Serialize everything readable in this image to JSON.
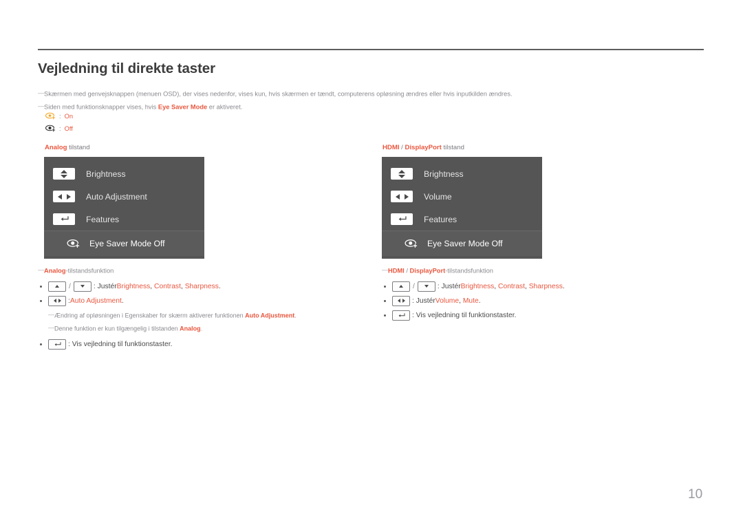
{
  "page": {
    "title": "Vejledning til direkte taster",
    "page_number": "10",
    "colors": {
      "accent": "#e8573f",
      "osd_background": "#555555",
      "osd_row_highlight": "#5b5b5b",
      "text": "#4a4a4a",
      "muted": "#8a8a90",
      "rule": "#5d5d5d",
      "page_number": "#9a9aa0"
    }
  },
  "intro": {
    "note1": "Skærmen med genvejsknappen (menuen OSD), der vises nedenfor, vises kun, hvis skærmen er tændt, computerens opløsning ændres eller hvis inputkilden ændres.",
    "note2_pre": "Siden med funktionsknapper vises, hvis ",
    "note2_hl": "Eye Saver Mode",
    "note2_post": " er aktiveret.",
    "legend": [
      {
        "icon": "eye-saver-on-icon",
        "sep": ":",
        "label": "On"
      },
      {
        "icon": "eye-saver-off-icon",
        "sep": ":",
        "label": "Off"
      }
    ]
  },
  "left_column": {
    "section_label_hl": "Analog",
    "section_label_rest": " tilstand",
    "osd": {
      "rows": [
        {
          "key": "up-down-key",
          "label": "Brightness"
        },
        {
          "key": "left-right-key",
          "label": "Auto Adjustment"
        },
        {
          "key": "enter-key",
          "label": "Features"
        }
      ],
      "eye_row": {
        "icon": "eye-saver-icon",
        "label": "Eye Saver Mode Off"
      }
    },
    "subtitle_hl": "Analog",
    "subtitle_rest": "-tilstandsfunktion",
    "bullets": [
      {
        "keys": [
          "up-key",
          "down-key"
        ],
        "prefix": ": Justér ",
        "terms": [
          "Brightness",
          "Contrast",
          "Sharpness"
        ],
        "suffix": "."
      },
      {
        "keys": [
          "left-right-key"
        ],
        "prefix": ": ",
        "terms": [
          "Auto Adjustment"
        ],
        "suffix": "."
      },
      {
        "keys": [
          "enter-key"
        ],
        "prefix": ": Vis vejledning til funktionstaster.",
        "terms": [],
        "suffix": ""
      }
    ],
    "indent_notes": [
      {
        "pre": "Ændring af opløsningen i Egenskaber for skærm aktiverer funktionen ",
        "hl": "Auto Adjustment",
        "post": "."
      },
      {
        "pre": "Denne funktion er kun tilgængelig i tilstanden ",
        "hl": "Analog",
        "post": "."
      }
    ]
  },
  "right_column": {
    "section_label_hl1": "HDMI",
    "section_label_sep": " / ",
    "section_label_hl2": "DisplayPort",
    "section_label_rest": " tilstand",
    "osd": {
      "rows": [
        {
          "key": "up-down-key",
          "label": "Brightness"
        },
        {
          "key": "left-right-key",
          "label": "Volume"
        },
        {
          "key": "enter-key",
          "label": "Features"
        }
      ],
      "eye_row": {
        "icon": "eye-saver-icon",
        "label": "Eye Saver Mode Off"
      }
    },
    "subtitle_hl1": "HDMI",
    "subtitle_sep": " / ",
    "subtitle_hl2": "DisplayPort",
    "subtitle_rest": "-tilstandsfunktion",
    "bullets": [
      {
        "keys": [
          "up-key",
          "down-key"
        ],
        "prefix": ": Justér ",
        "terms": [
          "Brightness",
          "Contrast",
          "Sharpness"
        ],
        "suffix": "."
      },
      {
        "keys": [
          "left-right-key"
        ],
        "prefix": ": Justér ",
        "terms": [
          "Volume",
          "Mute"
        ],
        "suffix": "."
      },
      {
        "keys": [
          "enter-key"
        ],
        "prefix": ": Vis vejledning til funktionstaster.",
        "terms": [],
        "suffix": ""
      }
    ]
  }
}
